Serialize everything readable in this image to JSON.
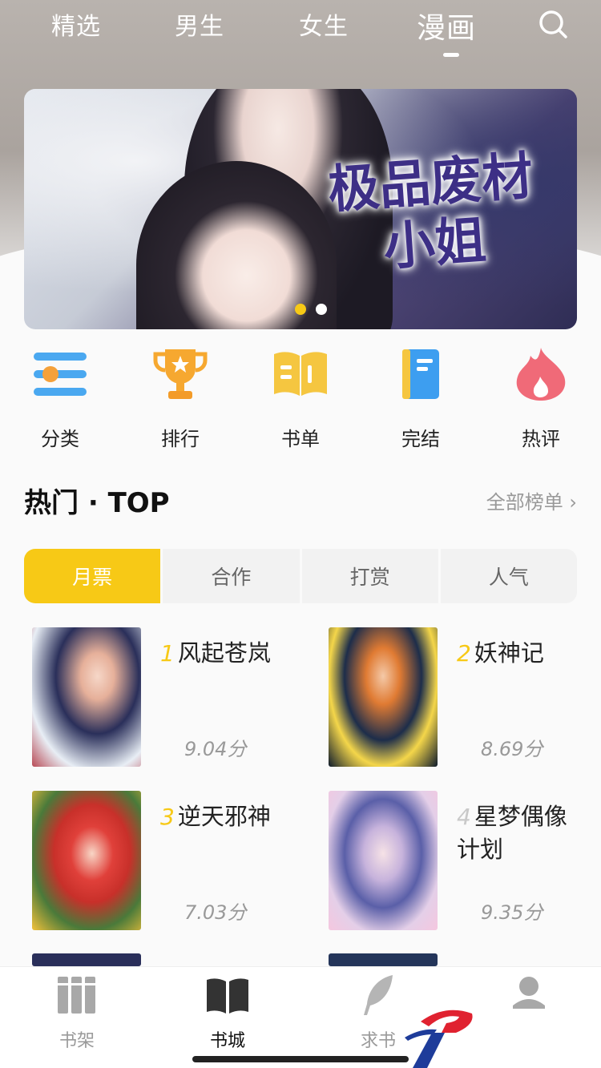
{
  "nav": {
    "tabs": [
      "精选",
      "男生",
      "女生",
      "漫画"
    ],
    "active_index": 3,
    "search_icon": "search-icon"
  },
  "banner": {
    "title_line1": "极品废材",
    "title_line2": "小姐",
    "page_count": 2,
    "active_page": 1
  },
  "categories": [
    {
      "label": "分类",
      "icon": "category-icon"
    },
    {
      "label": "排行",
      "icon": "trophy-icon"
    },
    {
      "label": "书单",
      "icon": "book-list-icon"
    },
    {
      "label": "完结",
      "icon": "completed-book-icon"
    },
    {
      "label": "热评",
      "icon": "flame-icon"
    }
  ],
  "hot": {
    "title": "热门 · TOP",
    "all_link": "全部榜单",
    "segments": [
      "月票",
      "合作",
      "打赏",
      "人气"
    ],
    "active_segment": 0
  },
  "books": [
    {
      "rank": "1",
      "title": "风起苍岚",
      "score": "9.04分"
    },
    {
      "rank": "2",
      "title": "妖神记",
      "score": "8.69分"
    },
    {
      "rank": "3",
      "title": "逆天邪神",
      "score": "7.03分"
    },
    {
      "rank": "4",
      "title": "星梦偶像计划",
      "score": "9.35分"
    }
  ],
  "tabbar": [
    {
      "label": "书架",
      "icon": "bookshelf-icon"
    },
    {
      "label": "书城",
      "icon": "open-book-icon"
    },
    {
      "label": "求书",
      "icon": "feather-icon"
    },
    {
      "label": "",
      "icon": "user-icon"
    }
  ],
  "colors": {
    "accent": "#f7c916",
    "text": "#222222",
    "muted": "#999999"
  }
}
